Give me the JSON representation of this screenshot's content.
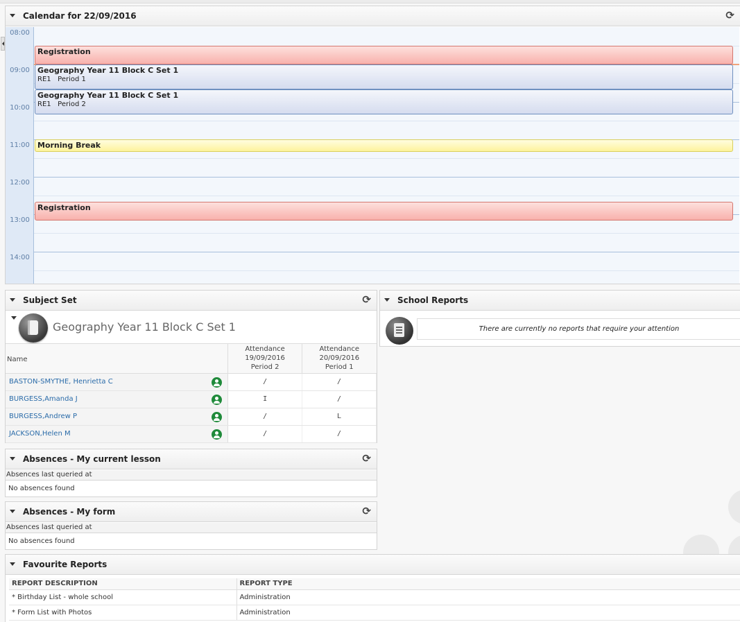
{
  "calendar": {
    "title": "Calendar for 22/09/2016",
    "times": [
      "08:00",
      "09:00",
      "10:00",
      "11:00",
      "12:00",
      "13:00",
      "14:00"
    ],
    "events": [
      {
        "title": "Registration",
        "sub": ""
      },
      {
        "title": "Geography Year 11 Block C Set 1",
        "sub": "RE1   Period 1"
      },
      {
        "title": "Geography Year 11 Block C Set 1",
        "sub": "RE1   Period 2"
      },
      {
        "title": "Morning Break",
        "sub": ""
      },
      {
        "title": "Registration",
        "sub": ""
      }
    ]
  },
  "subject_set": {
    "title": "Subject Set",
    "set_name": "Geography Year 11 Block C Set 1",
    "columns": {
      "name": "Name",
      "att1": [
        "Attendance",
        "19/09/2016",
        "Period 2"
      ],
      "att2": [
        "Attendance",
        "20/09/2016",
        "Period 1"
      ]
    },
    "rows": [
      {
        "name": "BASTON-SMYTHE, Henrietta C",
        "a1": "/",
        "a2": "/"
      },
      {
        "name": "BURGESS,Amanda J",
        "a1": "I",
        "a2": "/"
      },
      {
        "name": "BURGESS,Andrew P",
        "a1": "/",
        "a2": "L"
      },
      {
        "name": "JACKSON,Helen M",
        "a1": "/",
        "a2": "/"
      }
    ]
  },
  "absences_lesson": {
    "title": "Absences - My current lesson",
    "meta": "Absences last queried at",
    "none": "No absences found"
  },
  "absences_form": {
    "title": "Absences - My form",
    "meta": "Absences last queried at",
    "none": "No absences found"
  },
  "school_reports": {
    "title": "School Reports",
    "message": "There are currently no reports that require your attention"
  },
  "favourite_reports": {
    "title": "Favourite Reports",
    "headers": [
      "REPORT DESCRIPTION",
      "REPORT TYPE"
    ],
    "rows": [
      {
        "desc": "* Birthday List - whole school",
        "type": "Administration"
      },
      {
        "desc": "* Form List with Photos",
        "type": "Administration"
      }
    ]
  },
  "icons": {
    "collapse": "triangle-down-icon",
    "refresh": "refresh-icon",
    "book": "book-icon",
    "person": "person-icon",
    "report": "report-icon"
  },
  "colors": {
    "registration": "#f8b1ac",
    "lesson": "#d5dcef",
    "break": "#fdf39c",
    "student_link": "#2a6ba9",
    "person_icon": "#1f8a3a"
  }
}
